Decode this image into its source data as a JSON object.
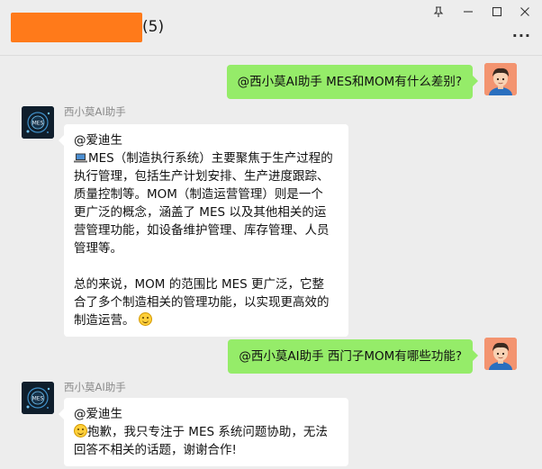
{
  "window": {
    "member_count": "(5)",
    "pin_icon": "pin-icon",
    "minimize_icon": "minimize-icon",
    "maximize_icon": "maximize-icon",
    "close_icon": "close-icon",
    "more_icon": "more-icon"
  },
  "messages": [
    {
      "direction": "outgoing",
      "text": "@西小莫AI助手 MES和MOM有什么差别?"
    },
    {
      "direction": "incoming",
      "sender": "西小莫AI助手",
      "lines": [
        "@爱迪生",
        "MES（制造执行系统）主要聚焦于生产过程的",
        "执行管理，包括生产计划安排、生产进度跟踪、",
        "质量控制等。MOM（制造运营管理）则是一个",
        "更广泛的概念，涵盖了 MES 以及其他相关的运",
        "营管理功能，如设备维护管理、库存管理、人员",
        "管理等。",
        "总的来说，MOM 的范围比 MES 更广泛，它整",
        "合了多个制造相关的管理功能，以实现更高效的",
        "制造运营。"
      ]
    },
    {
      "direction": "outgoing",
      "text": "@西小莫AI助手 西门子MOM有哪些功能?"
    },
    {
      "direction": "incoming",
      "sender": "西小莫AI助手",
      "lines": [
        "@爱迪生",
        "抱歉，我只专注于 MES 系统问题协助，无法",
        "回答不相关的话题，谢谢合作!"
      ]
    }
  ],
  "ai_avatar_logo": "MES"
}
